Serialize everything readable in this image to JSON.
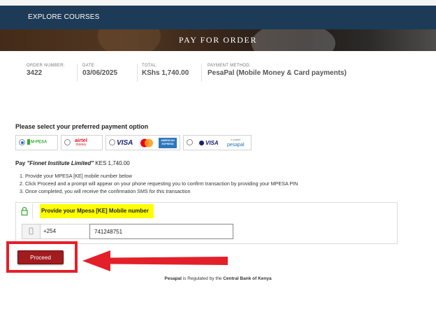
{
  "nav": {
    "link": "EXPLORE COURSES"
  },
  "banner": {
    "title": "PAY FOR ORDER"
  },
  "order": [
    {
      "label": "ORDER NUMBER:",
      "value": "3422"
    },
    {
      "label": "DATE:",
      "value": "03/06/2025"
    },
    {
      "label": "TOTAL:",
      "value": "KShs 1,740.00"
    },
    {
      "label": "PAYMENT METHOD:",
      "value": "PesaPal (Mobile Money & Card payments)"
    }
  ],
  "payment": {
    "title": "Please select your preferred payment option",
    "options": [
      {
        "name": "M-PESA",
        "selected": true,
        "icon": "mpesa-logo"
      },
      {
        "name": "airtel money",
        "selected": false,
        "icon": "airtel-logo"
      },
      {
        "name": "VISA / Mastercard / American Express",
        "selected": false,
        "icon": "card-logos"
      },
      {
        "name": "VISA e-wallet pesapal",
        "selected": false,
        "icon": "pesapal-logo"
      }
    ],
    "logos": {
      "mpesa": "M-PESA",
      "airtel": "airtel",
      "airtel_sub": "money",
      "visa": "VISA",
      "amex": "AMERICAN EXPRESS",
      "visa2": "VISA",
      "pesapal_top": "e-wallet",
      "pesapal": "pesapal"
    },
    "pay_prefix": "Pay ",
    "merchant": "\"Finnet Institute Limited\"",
    "amount": " KES 1,740.00",
    "steps": [
      "1. Provide your MPESA [KE] mobile number below",
      "2. Click Proceed and a prompt will appear on your phone requesting you to confirm transaction by providing your MPESA PIN",
      "3. Once completed, you will receive the confirmation SMS for this transaction"
    ],
    "mobile_label": "Provide your Mpesa [KE] Mobile number",
    "country_code": "+254",
    "phone_value": "741248751",
    "proceed_label": "Proceed"
  },
  "footer": {
    "brand": "Pesapal",
    "middle": " is Regulated by the ",
    "regulator": "Central Bank of Kenya"
  },
  "colors": {
    "nav": "#1d3b57",
    "proceed": "#a21b1f",
    "annotation": "#e3202a",
    "highlight": "#ffff00"
  }
}
